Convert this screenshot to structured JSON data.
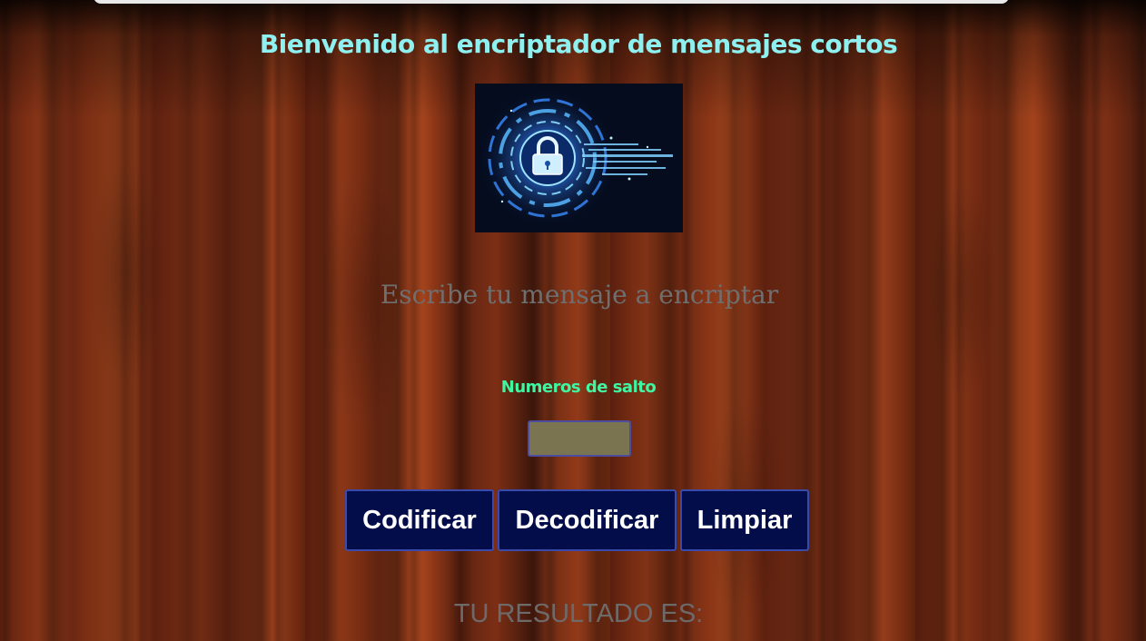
{
  "header": {
    "title": "Bienvenido al encriptador de mensajes cortos"
  },
  "hero": {
    "image_icon": "padlock-icon"
  },
  "message": {
    "placeholder": "Escribe tu mensaje a encriptar",
    "value": ""
  },
  "jump": {
    "label": "Numeros de salto",
    "value": ""
  },
  "actions": {
    "encode_label": "Codificar",
    "decode_label": "Decodificar",
    "clear_label": "Limpiar"
  },
  "result": {
    "label": "TU RESULTADO ES:"
  },
  "colors": {
    "title": "#8ff0f0",
    "jump_label": "#3ff7a2",
    "button_bg": "#020d4a",
    "input_bg": "#7a7451"
  }
}
